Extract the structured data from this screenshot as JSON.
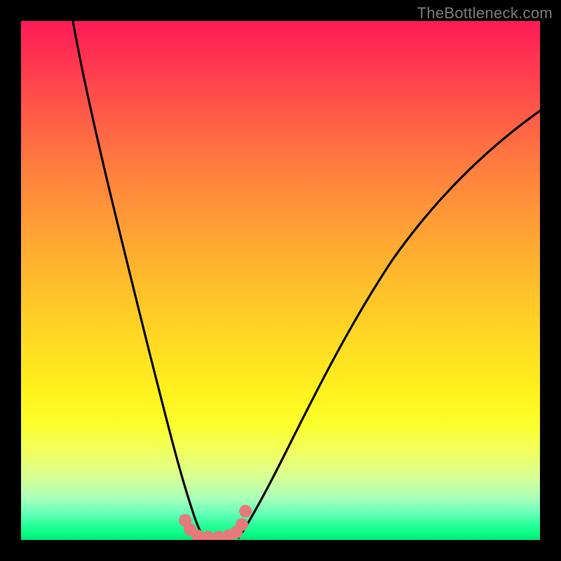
{
  "watermark": {
    "text": "TheBottleneck.com"
  },
  "colors": {
    "background": "#000000",
    "curve": "#000000",
    "marker": "#e47a7a",
    "gradient_top": "#ff1a58",
    "gradient_bottom": "#00e878"
  },
  "chart_data": {
    "type": "line",
    "title": "",
    "xlabel": "",
    "ylabel": "",
    "xlim": [
      0,
      100
    ],
    "ylim": [
      0,
      100
    ],
    "note": "Axes are unlabeled in the image; values below are normalized 0–100 estimates read off pixel positions (x left→right, y bottom→top).",
    "series": [
      {
        "name": "left-branch",
        "x": [
          10,
          12,
          15,
          18,
          21,
          24,
          26,
          28,
          30,
          31.5,
          33,
          34.5
        ],
        "y": [
          100,
          90,
          78,
          65,
          52,
          38,
          27,
          17,
          9,
          4,
          1.5,
          0.5
        ]
      },
      {
        "name": "right-branch",
        "x": [
          42,
          44,
          47,
          51,
          56,
          62,
          68,
          75,
          82,
          90,
          100
        ],
        "y": [
          0.5,
          3,
          9,
          18,
          29,
          41,
          52,
          62,
          70,
          77,
          83
        ]
      }
    ],
    "markers": {
      "name": "bottom-dots",
      "x": [
        31.5,
        32.5,
        34,
        36,
        38,
        40,
        41.5,
        42.5,
        43.2
      ],
      "y": [
        3.8,
        2.0,
        0.8,
        0.6,
        0.6,
        0.8,
        1.5,
        3.0,
        5.5
      ]
    }
  }
}
